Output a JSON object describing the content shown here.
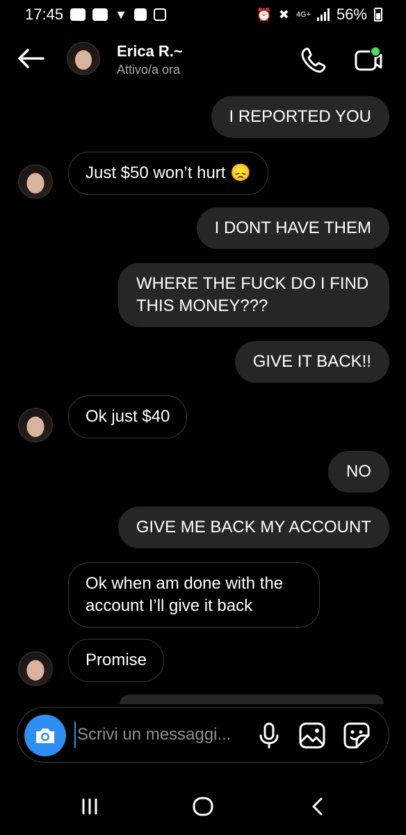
{
  "status_bar": {
    "time": "17:45",
    "network": "4G+",
    "battery": "56%"
  },
  "header": {
    "contact_name": "Erica R.~",
    "contact_status": "Attivo/a ora",
    "icons": [
      "back-arrow-icon",
      "phone-icon",
      "video-call-icon"
    ],
    "online_dot_color": "#4cd964"
  },
  "messages": [
    {
      "side": "out",
      "text": "I REPORTED YOU"
    },
    {
      "side": "in",
      "text": "Just $50 won’t hurt 😞"
    },
    {
      "side": "out",
      "text": "I DONT HAVE THEM"
    },
    {
      "side": "out",
      "text": "WHERE THE FUCK DO I FIND THIS MONEY???"
    },
    {
      "side": "out",
      "text": "GIVE IT BACK!!"
    },
    {
      "side": "in",
      "text": "Ok just $40"
    },
    {
      "side": "out",
      "text": "NO"
    },
    {
      "side": "out",
      "text": "GIVE ME BACK MY ACCOUNT"
    },
    {
      "side": "in",
      "text": "Ok when am done with the account I’ll give it back"
    },
    {
      "side": "in",
      "text": "Promise"
    }
  ],
  "composer": {
    "placeholder": "Scrivi un messaggi...",
    "camera_color": "#2f8ef2",
    "icons": [
      "camera-icon",
      "microphone-icon",
      "gallery-icon",
      "sticker-icon"
    ]
  },
  "nav_bar": {
    "icons": [
      "recent-apps-icon",
      "home-icon",
      "back-icon"
    ]
  }
}
